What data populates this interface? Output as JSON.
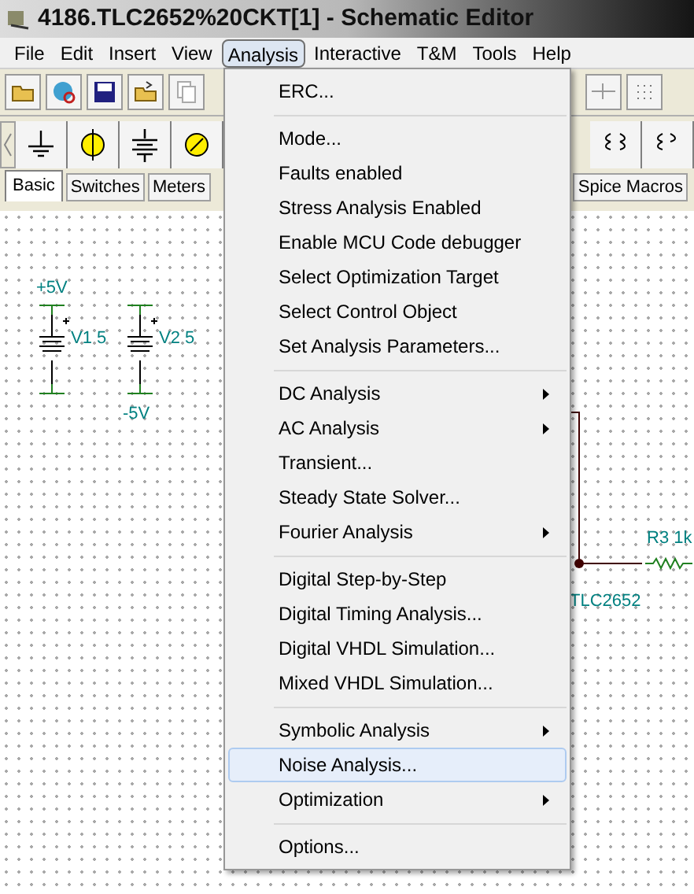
{
  "window": {
    "title": "4186.TLC2652%20CKT[1] - Schematic Editor"
  },
  "menubar": [
    {
      "label": "File",
      "selected": false
    },
    {
      "label": "Edit",
      "selected": false
    },
    {
      "label": "Insert",
      "selected": false
    },
    {
      "label": "View",
      "selected": false
    },
    {
      "label": "Analysis",
      "selected": true
    },
    {
      "label": "Interactive",
      "selected": false
    },
    {
      "label": "T&M",
      "selected": false
    },
    {
      "label": "Tools",
      "selected": false
    },
    {
      "label": "Help",
      "selected": false
    }
  ],
  "component_tabs": [
    {
      "label": "Basic",
      "selected": true
    },
    {
      "label": "Switches",
      "selected": false
    },
    {
      "label": "Meters",
      "selected": false
    },
    {
      "label": "Spice Macros",
      "selected": false
    }
  ],
  "canvas_labels": [
    {
      "text": "+5V"
    },
    {
      "text": "V1 5"
    },
    {
      "text": "V2 5"
    },
    {
      "text": "-5V"
    },
    {
      "text": "TLC2652"
    },
    {
      "text": "R3 1k"
    }
  ],
  "analysis_menu": [
    {
      "kind": "item",
      "label": "ERC...",
      "selected": false
    },
    {
      "kind": "separator"
    },
    {
      "kind": "item",
      "label": "Mode...",
      "selected": false
    },
    {
      "kind": "item",
      "label": "Faults enabled",
      "selected": false
    },
    {
      "kind": "item",
      "label": "Stress Analysis Enabled",
      "selected": false
    },
    {
      "kind": "item",
      "label": "Enable MCU Code debugger",
      "selected": false
    },
    {
      "kind": "item",
      "label": "Select Optimization Target",
      "selected": false
    },
    {
      "kind": "item",
      "label": "Select Control Object",
      "selected": false
    },
    {
      "kind": "item",
      "label": "Set Analysis Parameters...",
      "selected": false
    },
    {
      "kind": "separator"
    },
    {
      "kind": "submenu",
      "label": "DC Analysis",
      "selected": false
    },
    {
      "kind": "submenu",
      "label": "AC Analysis",
      "selected": false
    },
    {
      "kind": "item",
      "label": "Transient...",
      "selected": false
    },
    {
      "kind": "item",
      "label": "Steady State Solver...",
      "selected": false
    },
    {
      "kind": "submenu",
      "label": "Fourier Analysis",
      "selected": false
    },
    {
      "kind": "separator"
    },
    {
      "kind": "item",
      "label": "Digital Step-by-Step",
      "selected": false
    },
    {
      "kind": "item",
      "label": "Digital Timing Analysis...",
      "selected": false
    },
    {
      "kind": "item",
      "label": "Digital VHDL Simulation...",
      "selected": false
    },
    {
      "kind": "item",
      "label": "Mixed VHDL Simulation...",
      "selected": false
    },
    {
      "kind": "separator"
    },
    {
      "kind": "submenu",
      "label": "Symbolic Analysis",
      "selected": false
    },
    {
      "kind": "item",
      "label": "Noise Analysis...",
      "selected": true
    },
    {
      "kind": "submenu",
      "label": "Optimization",
      "selected": false
    },
    {
      "kind": "separator"
    },
    {
      "kind": "item",
      "label": "Options...",
      "selected": false
    }
  ]
}
